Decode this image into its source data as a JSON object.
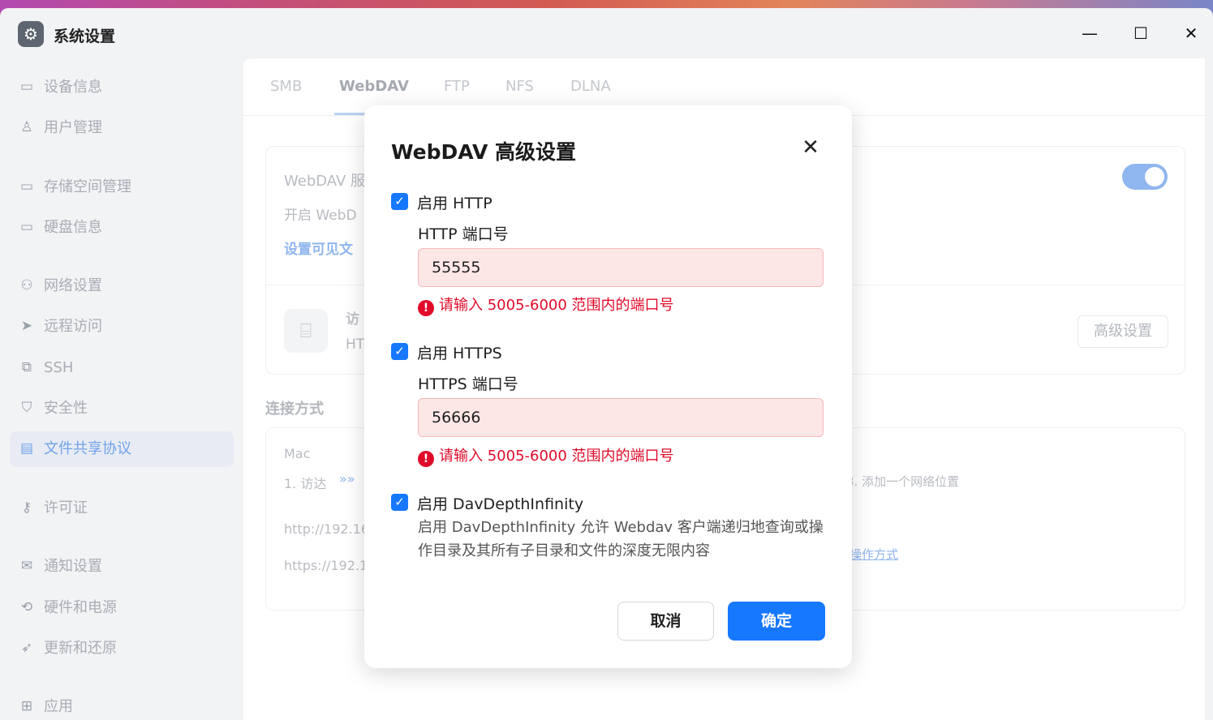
{
  "window": {
    "title": "系统设置",
    "app_icon": "gear-icon",
    "minimize": "—",
    "maximize": "☐",
    "close": "✕"
  },
  "sidebar": {
    "items": [
      {
        "label": "设备信息",
        "icon": "drive-icon",
        "glyph": "▭"
      },
      {
        "label": "用户管理",
        "icon": "user-icon",
        "glyph": "♙"
      },
      {
        "label": "存储空间管理",
        "icon": "storage-icon",
        "glyph": "▭"
      },
      {
        "label": "硬盘信息",
        "icon": "disk-icon",
        "glyph": "▭"
      },
      {
        "label": "网络设置",
        "icon": "network-icon",
        "glyph": "⚇"
      },
      {
        "label": "远程访问",
        "icon": "send-icon",
        "glyph": "➤"
      },
      {
        "label": "SSH",
        "icon": "ssh-icon",
        "glyph": "⧉"
      },
      {
        "label": "安全性",
        "icon": "shield-icon",
        "glyph": "⛉"
      },
      {
        "label": "文件共享协议",
        "icon": "file-icon",
        "glyph": "▤"
      },
      {
        "label": "许可证",
        "icon": "key-icon",
        "glyph": "⚷"
      },
      {
        "label": "通知设置",
        "icon": "mail-icon",
        "glyph": "✉"
      },
      {
        "label": "硬件和电源",
        "icon": "power-icon",
        "glyph": "⟲"
      },
      {
        "label": "更新和还原",
        "icon": "rocket-icon",
        "glyph": "➶"
      },
      {
        "label": "应用",
        "icon": "apps-icon",
        "glyph": "⊞"
      }
    ],
    "active_index": 8
  },
  "tabs": [
    "SMB",
    "WebDAV",
    "FTP",
    "NFS",
    "DLNA"
  ],
  "active_tab": "WebDAV",
  "background": {
    "service_title": "WebDAV 服",
    "service_desc": "开启 WebD",
    "visible_link": "设置可见文",
    "access_title": "访",
    "access_sub": "HT",
    "advanced_button": "高级设置",
    "connection_heading": "连接方式",
    "mac_label": "Mac",
    "step1": "1. 访达",
    "step_arrows": "»»",
    "step3": "3. 添加一个网络位置",
    "http_url": "http://192.16",
    "https_url": "https://192.1",
    "other_link": "操作方式"
  },
  "modal": {
    "title": "WebDAV 高级设置",
    "close_glyph": "✕",
    "check_glyph": "✓",
    "http": {
      "checkbox_label": "启用 HTTP",
      "port_label": "HTTP 端口号",
      "port_value": "55555",
      "error": "请输入 5005-6000 范围内的端口号"
    },
    "https": {
      "checkbox_label": "启用 HTTPS",
      "port_label": "HTTPS 端口号",
      "port_value": "56666",
      "error": "请输入 5005-6000 范围内的端口号"
    },
    "depth": {
      "checkbox_label": "启用 DavDepthInfinity",
      "description": "启用 DavDepthInfinity 允许 Webdav 客户端递归地查询或操作目录及其所有子目录和文件的深度无限内容"
    },
    "error_glyph": "!",
    "cancel_label": "取消",
    "confirm_label": "确定"
  },
  "colors": {
    "primary": "#1677ff",
    "error": "#e00b2a",
    "error_bg": "#fde6e6"
  }
}
